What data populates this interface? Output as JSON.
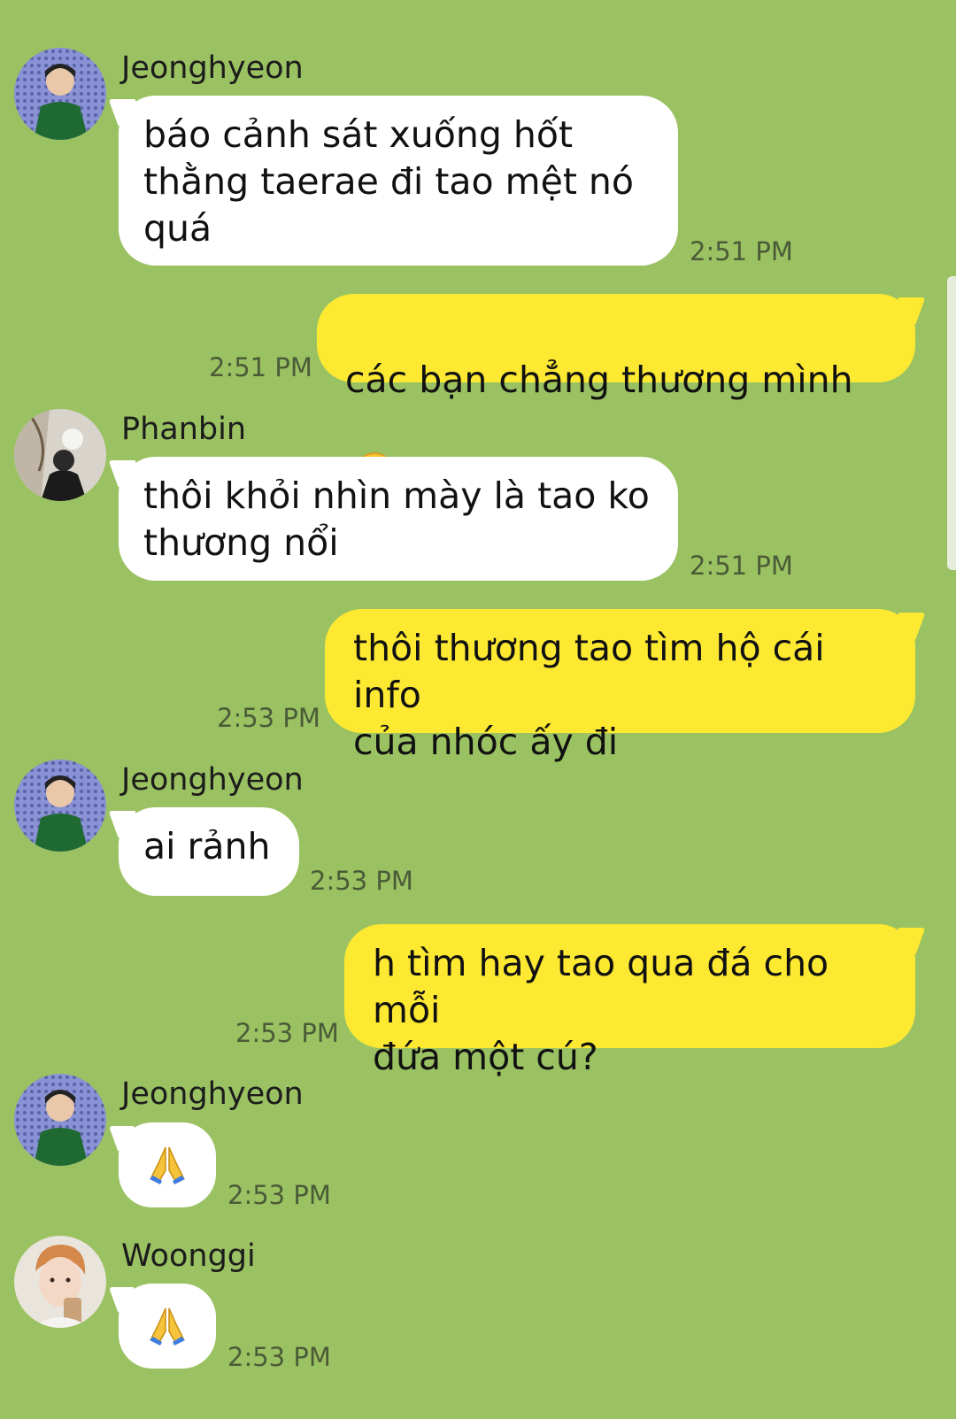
{
  "messages": [
    {
      "sender": "Jeonghyeon",
      "text": "báo cảnh sát xuống hốt\nthằng taerae đi tao mệt nó\nquá",
      "time": "2:51 PM",
      "direction": "in"
    },
    {
      "text": "các bạn chẳng thương mình",
      "emoji": "crying-face",
      "time": "2:51 PM",
      "direction": "out"
    },
    {
      "sender": "Phanbin",
      "text": "thôi khỏi nhìn mày là tao ko\nthương nổi",
      "time": "2:51 PM",
      "direction": "in"
    },
    {
      "text": "thôi thương tao tìm hộ cái info\ncủa nhóc ấy đi",
      "time": "2:53 PM",
      "direction": "out"
    },
    {
      "sender": "Jeonghyeon",
      "text": "ai rảnh",
      "time": "2:53 PM",
      "direction": "in"
    },
    {
      "text": "h tìm hay tao qua đá cho mỗi\nđứa một cú?",
      "time": "2:53 PM",
      "direction": "out"
    },
    {
      "sender": "Jeonghyeon",
      "emoji": "folded-hands",
      "time": "2:53 PM",
      "direction": "in"
    },
    {
      "sender": "Woonggi",
      "emoji": "folded-hands",
      "time": "2:53 PM",
      "direction": "in"
    }
  ],
  "colors": {
    "background": "#9bc262",
    "incoming_bubble": "#ffffff",
    "outgoing_bubble": "#fde932"
  }
}
